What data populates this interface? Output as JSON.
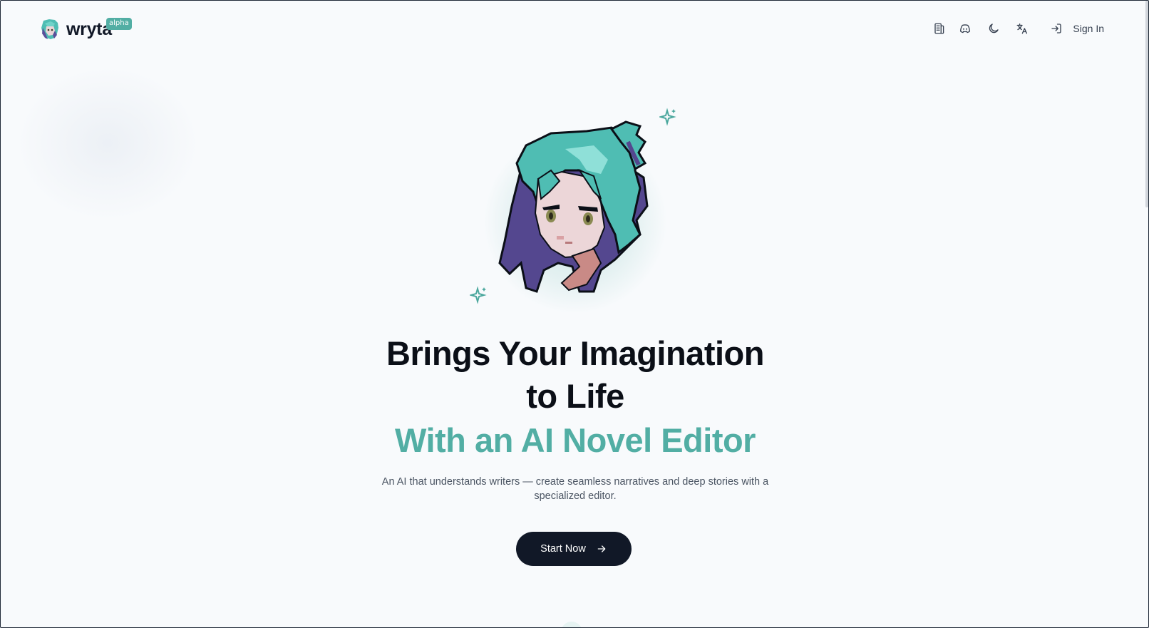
{
  "header": {
    "brand": "wryta",
    "badge": "alpha",
    "nav_icons": [
      "docs-icon",
      "discord-icon",
      "moon-icon",
      "translate-icon"
    ],
    "signin_label": "Sign In"
  },
  "hero": {
    "title_line1": "Brings Your Imagination",
    "title_line2": "to Life",
    "title_accent": "With an AI Novel Editor",
    "subtitle": "An AI that understands writers — create seamless narratives and deep stories with a specialized editor.",
    "cta_label": "Start Now"
  },
  "colors": {
    "accent": "#52aea4",
    "dark": "#111827",
    "background": "#f8fafc"
  }
}
